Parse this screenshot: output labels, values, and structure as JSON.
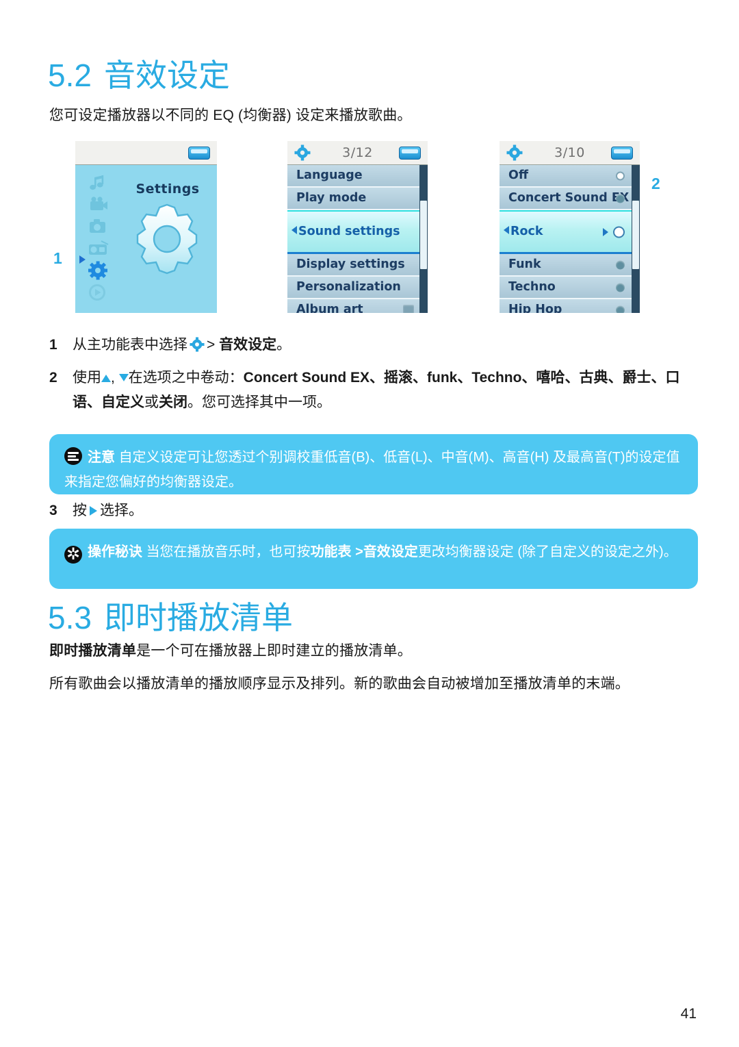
{
  "page": {
    "number": "41"
  },
  "sections": [
    {
      "num": "5.2",
      "title": "音效设定"
    },
    {
      "num": "5.3",
      "title": "即时播放清单"
    }
  ],
  "intro_paragraph": "您可设定播放器以不同的 EQ (均衡器) 设定来播放歌曲。",
  "screens": {
    "screen1": {
      "callout_number": "1",
      "title": "Settings",
      "rail_icons": [
        "music-note-icon",
        "video-camera-icon",
        "photo-camera-icon",
        "radio-icon",
        "gear-icon",
        "play-circle-icon"
      ],
      "selected_rail_icon": "gear-icon"
    },
    "screen2": {
      "status_counter": "3/12",
      "items": [
        {
          "label": "Language",
          "selected": false,
          "control": "none"
        },
        {
          "label": "Play mode",
          "selected": false,
          "control": "none"
        },
        {
          "label": "Sound settings",
          "selected": true,
          "control": "none"
        },
        {
          "label": "Display settings",
          "selected": false,
          "control": "none"
        },
        {
          "label": "Personalization",
          "selected": false,
          "control": "none"
        },
        {
          "label": "Album art",
          "selected": false,
          "control": "square"
        }
      ]
    },
    "screen3": {
      "callout_number": "2",
      "status_counter": "3/10",
      "items": [
        {
          "label": "Off",
          "selected": false,
          "control": "radio-on"
        },
        {
          "label": "Concert Sound EX",
          "selected": false,
          "control": "radio-off"
        },
        {
          "label": "Rock",
          "selected": true,
          "control": "radio-big"
        },
        {
          "label": "Funk",
          "selected": false,
          "control": "radio-off"
        },
        {
          "label": "Techno",
          "selected": false,
          "control": "radio-off"
        },
        {
          "label": "Hip Hop",
          "selected": false,
          "control": "radio-off"
        }
      ]
    }
  },
  "steps": [
    {
      "num": "1",
      "text_before": "从主功能表中选择",
      "icon": "gear-icon",
      "text_mid": "> ",
      "bold_text": "音效设定",
      "text_after": "。"
    },
    {
      "num": "2",
      "prefix": "使用",
      "icons": [
        "triangle-up-icon",
        "triangle-down-icon"
      ],
      "mid": "在选项之中卷动：",
      "options_bold": "Concert Sound EX、摇滚、funk、Techno、嘻哈、古典、爵士、口语、自定义",
      "connector": "或",
      "last_bold": "关闭",
      "suffix": "。您可选择其中一项。"
    },
    {
      "num": "3",
      "text_before": "按",
      "icon": "triangle-right-icon",
      "text_after": "选择。"
    }
  ],
  "callouts": [
    {
      "icon": "note-icon",
      "label": "注意",
      "text": "自定义设定可让您透过个别调校重低音(B)、低音(L)、中音(M)、高音(H) 及最高音(T)的设定值来指定您偏好的均衡器设定。"
    },
    {
      "icon": "tip-star-icon",
      "label": "操作秘诀",
      "text_1": "当您在播放音乐时，也可按",
      "bold_1": "功能表 >",
      "bold_2": "音效设定",
      "text_2": "更改均衡器设定 (除了自定义的设定之外)。"
    }
  ],
  "section53": {
    "para1_bold": "即时播放清单",
    "para1_rest": "是一个可在播放器上即时建立的播放清单。",
    "para2": "所有歌曲会以播放清单的播放顺序显示及排列。新的歌曲会自动被增加至播放清单的末端。"
  },
  "colors": {
    "heading_blue": "#29ABE2",
    "callout_bg": "#4FC8F2",
    "screen1_bg": "#8FD8EE",
    "list_row_bg": "#B3CFDD",
    "list_text": "#1D3D63",
    "selected_row": "#B9F2F2"
  }
}
